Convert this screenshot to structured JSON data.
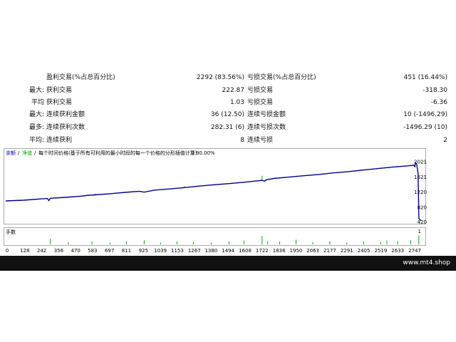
{
  "stats": {
    "rows": [
      {
        "prefix": "",
        "label1": "盈利交易(%占总百分比)",
        "value1": "2292 (83.56%)",
        "label2": "亏损交易(%占总百分比)",
        "value2": "451 (16.44%)"
      },
      {
        "prefix": "最大:",
        "label1": "获利交易",
        "value1": "222.87",
        "label2": "亏损交易",
        "value2": "-318.30"
      },
      {
        "prefix": "平均",
        "label1": "获利交易",
        "value1": "1.03",
        "label2": "亏损交易",
        "value2": "-6.36"
      },
      {
        "prefix": "最大:",
        "label1": "连续获利金额",
        "value1": "36 (12.50)",
        "label2": "连续亏损金额",
        "value2": "10 (-1496.29)"
      },
      {
        "prefix": "最多:",
        "label1": "连续获利次数",
        "value1": "282.31 (6)",
        "label2": "连续亏损次数",
        "value2": "-1496.29 (10)"
      },
      {
        "prefix": "平均:",
        "label1": "连续获利",
        "value1": "8",
        "label2": "连续亏损",
        "value2": "2"
      }
    ]
  },
  "chart_data": {
    "type": "line",
    "legend": [
      {
        "text": "余额",
        "color": "#0000aa"
      },
      {
        "text": "净值",
        "color": "#00aa00"
      },
      {
        "text": "每个时间价格(基于所有可利用的最小时段的每一个价格的分形插值计算)",
        "color": "#000000"
      }
    ],
    "quality": "90.00%",
    "volume_label": "手数",
    "x_ticks": [
      0,
      128,
      242,
      356,
      470,
      583,
      697,
      811,
      925,
      1039,
      1153,
      1267,
      1380,
      1494,
      1608,
      1722,
      1836,
      1950,
      2063,
      2177,
      2291,
      2405,
      2519,
      2633,
      2747
    ],
    "y_ticks": [
      2021,
      1621,
      1220,
      820,
      420
    ],
    "ylim": [
      420,
      2140
    ],
    "xlim": [
      0,
      2790
    ],
    "series": [
      {
        "role": "balance",
        "color": "#00008b",
        "x": [
          0,
          120,
          240,
          280,
          290,
          300,
          400,
          500,
          560,
          600,
          700,
          800,
          900,
          930,
          1000,
          1100,
          1200,
          1300,
          1400,
          1500,
          1600,
          1720,
          1740,
          1750,
          1800,
          1900,
          2000,
          2100,
          2200,
          2300,
          2400,
          2500,
          2600,
          2700,
          2740,
          2748,
          2752,
          2760,
          2770,
          2775,
          2790
        ],
        "y": [
          980,
          1000,
          1035,
          1045,
          990,
          1050,
          1075,
          1105,
          1130,
          1140,
          1170,
          1205,
          1235,
          1210,
          1265,
          1295,
          1330,
          1370,
          1405,
          1435,
          1470,
          1520,
          1500,
          1535,
          1570,
          1605,
          1640,
          1675,
          1715,
          1750,
          1790,
          1830,
          1870,
          1900,
          1920,
          1880,
          1985,
          1960,
          1700,
          520,
          460
        ]
      }
    ],
    "equity_spikes": [
      {
        "x": 1722,
        "y": 1640
      },
      {
        "x": 1200,
        "y": 1360
      },
      {
        "x": 600,
        "y": 1170
      },
      {
        "x": 2630,
        "y": 1900
      }
    ],
    "volume_bars": [
      {
        "x": 300,
        "v": 0.6
      },
      {
        "x": 420,
        "v": 0.25
      },
      {
        "x": 580,
        "v": 0.3
      },
      {
        "x": 700,
        "v": 0.2
      },
      {
        "x": 810,
        "v": 0.35
      },
      {
        "x": 930,
        "v": 0.45
      },
      {
        "x": 1040,
        "v": 0.2
      },
      {
        "x": 1150,
        "v": 0.3
      },
      {
        "x": 1260,
        "v": 0.25
      },
      {
        "x": 1380,
        "v": 0.2
      },
      {
        "x": 1500,
        "v": 0.3
      },
      {
        "x": 1600,
        "v": 0.4
      },
      {
        "x": 1722,
        "v": 0.9
      },
      {
        "x": 1760,
        "v": 0.35
      },
      {
        "x": 1840,
        "v": 0.3
      },
      {
        "x": 1950,
        "v": 0.5
      },
      {
        "x": 2063,
        "v": 0.25
      },
      {
        "x": 2177,
        "v": 0.35
      },
      {
        "x": 2291,
        "v": 0.2
      },
      {
        "x": 2405,
        "v": 0.3
      },
      {
        "x": 2519,
        "v": 0.25
      },
      {
        "x": 2560,
        "v": 0.4
      },
      {
        "x": 2633,
        "v": 0.35
      },
      {
        "x": 2720,
        "v": 0.45
      },
      {
        "x": 2775,
        "v": 0.95
      }
    ],
    "volume_axis_label": "1"
  },
  "footer": {
    "site": "www.mt4.shop"
  },
  "colors": {
    "footer_bg": "#111111",
    "balance": "#00008b",
    "equity": "#00aa00",
    "grid_border": "#aaaaaa"
  }
}
